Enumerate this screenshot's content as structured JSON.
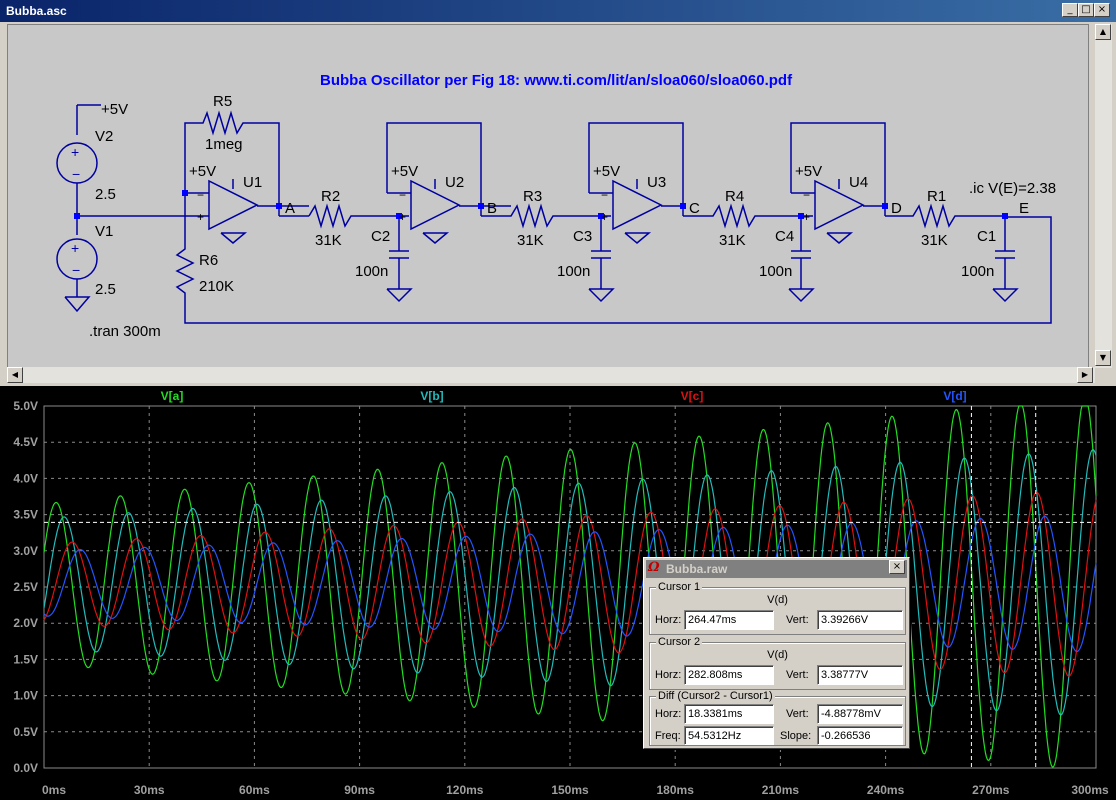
{
  "window": {
    "title": "Bubba.asc"
  },
  "schematic": {
    "title_text": "Bubba Oscillator per Fig 18: www.ti.com/lit/an/sloa060/sloa060.pdf",
    "directives": {
      "tran": ".tran 300m",
      "ic": ".ic V(E)=2.38"
    },
    "sources": [
      {
        "name": "V2",
        "value": "2.5",
        "supply": "+5V"
      },
      {
        "name": "V1",
        "value": "2.5"
      }
    ],
    "opamps": [
      {
        "name": "U1",
        "supply": "+5V"
      },
      {
        "name": "U2",
        "supply": "+5V"
      },
      {
        "name": "U3",
        "supply": "+5V"
      },
      {
        "name": "U4",
        "supply": "+5V"
      }
    ],
    "resistors": [
      {
        "name": "R5",
        "value": "1meg"
      },
      {
        "name": "R6",
        "value": "210K"
      },
      {
        "name": "R2",
        "value": "31K"
      },
      {
        "name": "R3",
        "value": "31K"
      },
      {
        "name": "R4",
        "value": "31K"
      },
      {
        "name": "R1",
        "value": "31K"
      }
    ],
    "capacitors": [
      {
        "name": "C2",
        "value": "100n"
      },
      {
        "name": "C3",
        "value": "100n"
      },
      {
        "name": "C4",
        "value": "100n"
      },
      {
        "name": "C1",
        "value": "100n"
      }
    ],
    "nets": [
      "A",
      "B",
      "C",
      "D",
      "E"
    ]
  },
  "plot": {
    "traces": [
      {
        "name": "V[a]",
        "color": "#22dd22"
      },
      {
        "name": "V[b]",
        "color": "#22bbbb"
      },
      {
        "name": "V[c]",
        "color": "#dd1111"
      },
      {
        "name": "V[d]",
        "color": "#2255ff"
      }
    ],
    "cursor_level_label": "",
    "chart_data": {
      "type": "line",
      "xlim": [
        0,
        300
      ],
      "ylim": [
        0,
        5
      ],
      "x_ticks": [
        "0ms",
        "30ms",
        "60ms",
        "90ms",
        "120ms",
        "150ms",
        "180ms",
        "210ms",
        "240ms",
        "270ms",
        "300ms"
      ],
      "y_ticks": [
        "0.0V",
        "0.5V",
        "1.0V",
        "1.5V",
        "2.0V",
        "2.5V",
        "3.0V",
        "3.5V",
        "4.0V",
        "4.5V",
        "5.0V"
      ],
      "grid": true,
      "frequency_hz": 54.53,
      "series": [
        {
          "name": "V[a]",
          "center": 2.55,
          "amp_start": 1.1,
          "amp_end": 2.6,
          "phase_deg": 0,
          "clip": [
            0,
            5
          ]
        },
        {
          "name": "V[b]",
          "center": 2.55,
          "amp_start": 0.9,
          "amp_end": 1.85,
          "phase_deg": -45
        },
        {
          "name": "V[c]",
          "center": 2.55,
          "amp_start": 0.55,
          "amp_end": 1.3,
          "phase_deg": -90
        },
        {
          "name": "V[d]",
          "center": 2.55,
          "amp_start": 0.45,
          "amp_end": 0.95,
          "phase_deg": -135
        }
      ],
      "cursors": [
        {
          "name": "Cursor 1",
          "x": 264.47,
          "y": 3.39266
        },
        {
          "name": "Cursor 2",
          "x": 282.808,
          "y": 3.38777
        }
      ]
    }
  },
  "cursor_dialog": {
    "title": "Bubba.raw",
    "cursor1": {
      "label": "Cursor 1",
      "trace": "V(d)",
      "horz_label": "Horz:",
      "horz": "264.47ms",
      "vert_label": "Vert:",
      "vert": "3.39266V"
    },
    "cursor2": {
      "label": "Cursor 2",
      "trace": "V(d)",
      "horz_label": "Horz:",
      "horz": "282.808ms",
      "vert_label": "Vert:",
      "vert": "3.38777V"
    },
    "diff": {
      "label": "Diff (Cursor2 - Cursor1)",
      "horz_label": "Horz:",
      "horz": "18.3381ms",
      "vert_label": "Vert:",
      "vert": "-4.88778mV",
      "freq_label": "Freq:",
      "freq": "54.5312Hz",
      "slope_label": "Slope:",
      "slope": "-0.266536"
    }
  }
}
